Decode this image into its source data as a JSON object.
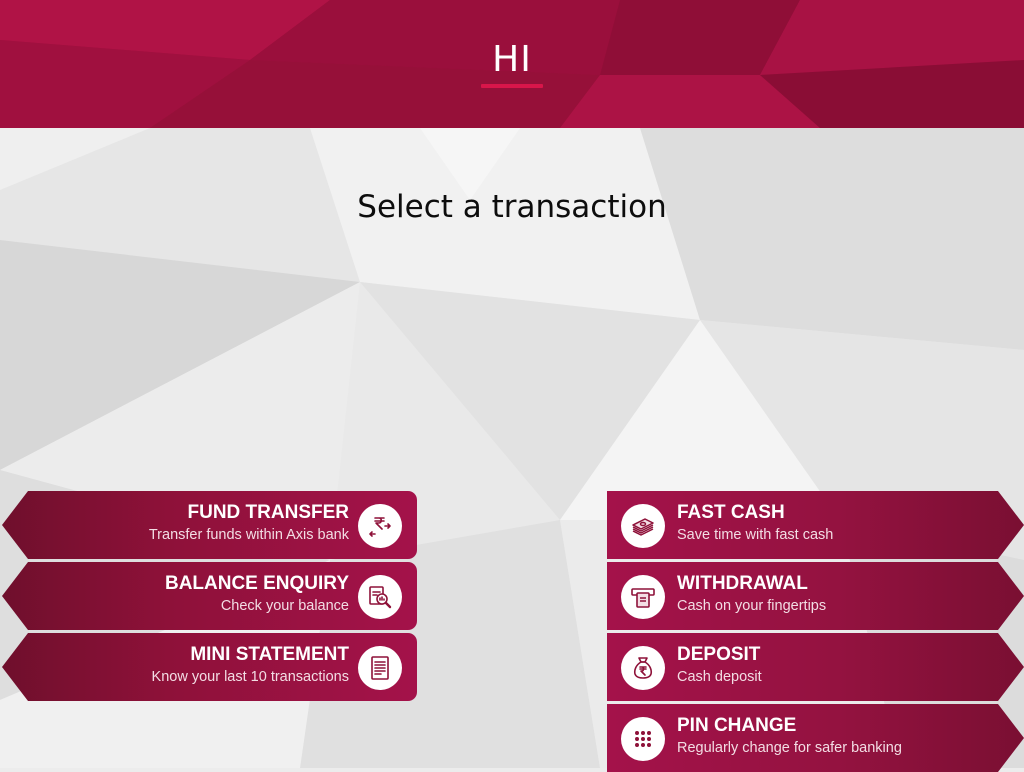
{
  "header": {
    "greeting": "HI"
  },
  "main": {
    "prompt": "Select a transaction"
  },
  "colors": {
    "brand": "#a4124a",
    "brand_dark": "#7a0f32",
    "accent_line": "#d8164a"
  },
  "left_options": [
    {
      "title": "FUND TRANSFER",
      "subtitle": "Transfer funds within Axis bank",
      "icon": "rupee-transfer-icon"
    },
    {
      "title": "BALANCE ENQUIRY",
      "subtitle": "Check your balance",
      "icon": "balance-search-icon"
    },
    {
      "title": "MINI STATEMENT",
      "subtitle": "Know your last 10 transactions",
      "icon": "statement-icon"
    }
  ],
  "right_options": [
    {
      "title": "FAST CASH",
      "subtitle": "Save time with fast cash",
      "icon": "cash-stack-icon"
    },
    {
      "title": "WITHDRAWAL",
      "subtitle": "Cash on your fingertips",
      "icon": "atm-withdraw-icon"
    },
    {
      "title": "DEPOSIT",
      "subtitle": "Cash deposit",
      "icon": "money-bag-icon"
    },
    {
      "title": "PIN CHANGE",
      "subtitle": "Regularly change for safer banking",
      "icon": "keypad-icon"
    }
  ]
}
